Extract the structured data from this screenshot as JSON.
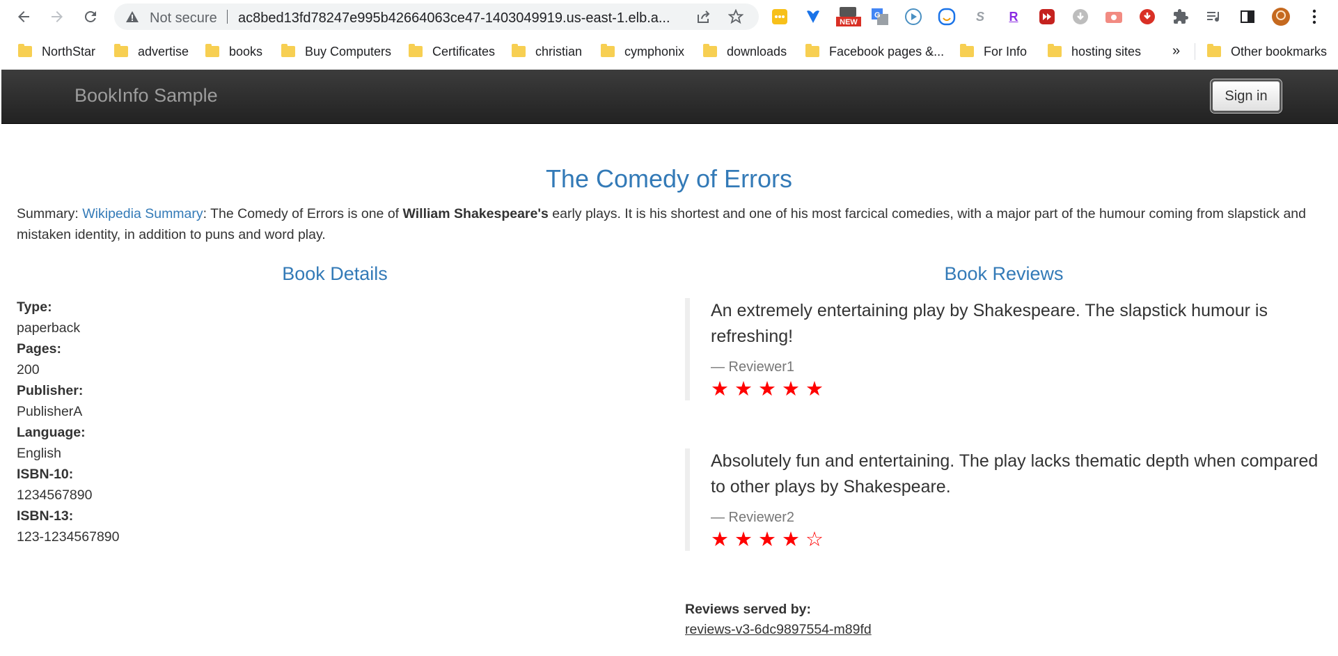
{
  "browser": {
    "security_text": "Not secure",
    "url": "ac8bed13fd78247e995b42664063ce47-1403049919.us-east-1.elb.a...",
    "extensions": [
      {
        "name": "extension-dots-icon"
      },
      {
        "name": "extension-heart-icon"
      },
      {
        "name": "extension-new-icon",
        "badge": "NEW"
      },
      {
        "name": "extension-translate-icon"
      },
      {
        "name": "extension-play-icon"
      },
      {
        "name": "extension-face-icon"
      },
      {
        "name": "extension-s-icon",
        "glyph": "S"
      },
      {
        "name": "extension-r-icon",
        "glyph": "R"
      },
      {
        "name": "extension-forward-icon"
      },
      {
        "name": "extension-download-icon"
      },
      {
        "name": "extension-camera-icon"
      },
      {
        "name": "extension-save-icon"
      }
    ]
  },
  "bookmarks": {
    "items": [
      "NorthStar",
      "advertise",
      "books",
      "Buy Computers",
      "Certificates",
      "christian",
      "cymphonix",
      "downloads",
      "Facebook pages &...",
      "For Info",
      "hosting sites"
    ],
    "more": "»",
    "other": "Other bookmarks"
  },
  "app": {
    "brand": "BookInfo Sample",
    "signin_label": "Sign in"
  },
  "book": {
    "title": "The Comedy of Errors",
    "summary_label": "Summary: ",
    "summary_link": "Wikipedia Summary",
    "summary_part1": ": The Comedy of Errors is one of ",
    "summary_bold": "William Shakespeare's",
    "summary_part2": " early plays. It is his shortest and one of his most farcical comedies, with a major part of the humour coming from slapstick and mistaken identity, in addition to puns and word play."
  },
  "details": {
    "heading": "Book Details",
    "fields": [
      {
        "label": "Type:",
        "value": "paperback"
      },
      {
        "label": "Pages:",
        "value": "200"
      },
      {
        "label": "Publisher:",
        "value": "PublisherA"
      },
      {
        "label": "Language:",
        "value": "English"
      },
      {
        "label": "ISBN-10:",
        "value": "1234567890"
      },
      {
        "label": "ISBN-13:",
        "value": "123-1234567890"
      }
    ]
  },
  "reviews": {
    "heading": "Book Reviews",
    "items": [
      {
        "text": "An extremely entertaining play by Shakespeare. The slapstick humour is refreshing!",
        "author": "— Reviewer1",
        "rating": 5,
        "max": 5
      },
      {
        "text": "Absolutely fun and entertaining. The play lacks thematic depth when compared to other plays by Shakespeare.",
        "author": "— Reviewer2",
        "rating": 4,
        "max": 5
      }
    ],
    "served_by_label": "Reviews served by:",
    "served_by_value": "reviews-v3-6dc9897554-m89fd",
    "star_color": "#ff0000"
  }
}
